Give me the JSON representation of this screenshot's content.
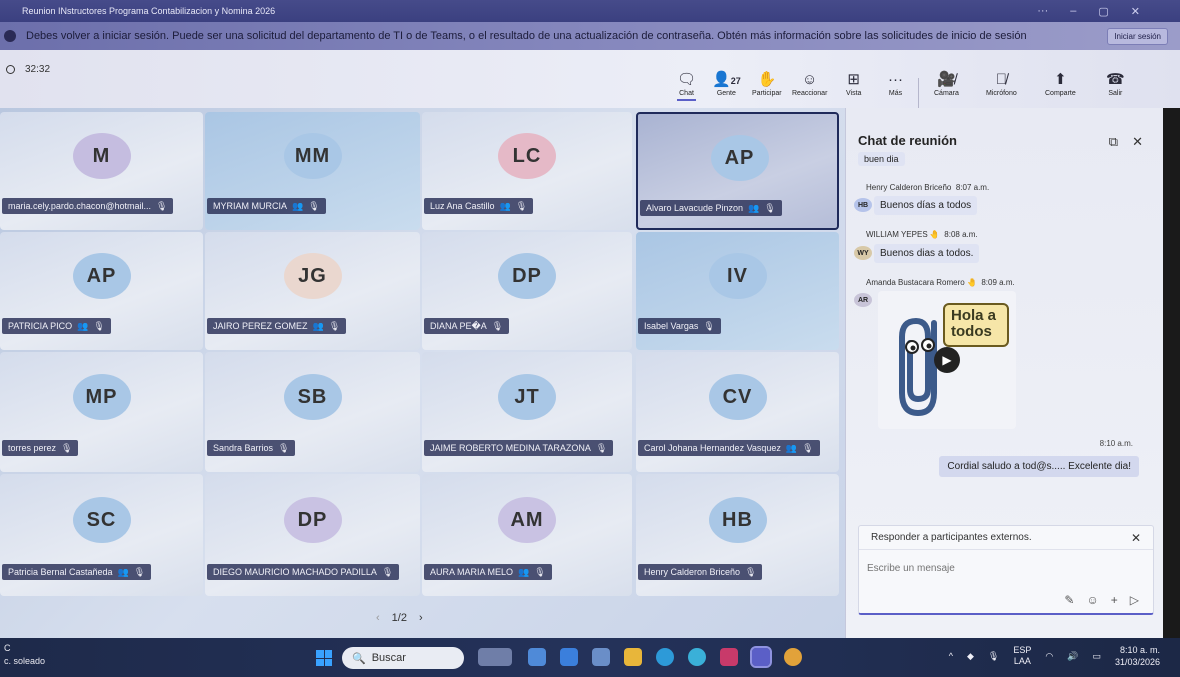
{
  "window": {
    "title": "Reunion INstructores Programa Contabilizacion y Nomina 2026",
    "controls": [
      "···",
      "–",
      "▢",
      "✕"
    ]
  },
  "banner": {
    "message": "Debes volver a iniciar sesión. Puede ser una solicitud del departamento de TI o de Teams, o el resultado de una actualización de contraseña. Obtén más información sobre las solicitudes de inicio de sesión",
    "button": "Iniciar sesión"
  },
  "toolbar": {
    "timer": "32:32",
    "people_count": "27",
    "buttons": {
      "chat": "Chat",
      "people": "Gente",
      "raise": "Participar",
      "react": "Reaccionar",
      "view": "Vista",
      "more": "Más",
      "camera": "Cámara",
      "mic": "Micrófono",
      "share": "Comparte",
      "leave": "Salir"
    },
    "icons": {
      "chat": "chat-icon",
      "people": "people-icon",
      "raise": "hand-icon",
      "react": "smile-icon",
      "view": "grid-icon",
      "more": "more-icon",
      "camera": "camera-off-icon",
      "mic": "mic-off-icon",
      "share": "share-icon",
      "leave": "phone-icon"
    }
  },
  "tiles": [
    {
      "initials": "M",
      "name": "maria.cely.pardo.chacon@hotmail...",
      "hand": false
    },
    {
      "initials": "MM",
      "name": "MYRIAM MURCIA",
      "hand": true
    },
    {
      "initials": "LC",
      "name": "Luz Ana Castillo",
      "hand": true
    },
    {
      "initials": "AP",
      "name": "Alvaro Lavacude Pinzon",
      "hand": true
    },
    {
      "initials": "AP",
      "name": "PATRICIA PICO",
      "hand": true
    },
    {
      "initials": "JG",
      "name": "JAIRO PEREZ GOMEZ",
      "hand": true
    },
    {
      "initials": "DP",
      "name": "DIANA PE�A",
      "hand": false
    },
    {
      "initials": "IV",
      "name": "Isabel Vargas",
      "hand": false
    },
    {
      "initials": "MP",
      "name": "torres perez",
      "hand": false
    },
    {
      "initials": "SB",
      "name": "Sandra Barrios",
      "hand": false
    },
    {
      "initials": "JT",
      "name": "JAIME ROBERTO MEDINA TARAZONA",
      "hand": false
    },
    {
      "initials": "CV",
      "name": "Carol Johana Hernandez Vasquez",
      "hand": true
    },
    {
      "initials": "SC",
      "name": "Patricia Bernal Castañeda",
      "hand": true
    },
    {
      "initials": "DP",
      "name": "DIEGO MAURICIO MACHADO PADILLA",
      "hand": false
    },
    {
      "initials": "AM",
      "name": "AURA MARIA MELO",
      "hand": true
    },
    {
      "initials": "HB",
      "name": "Henry Calderon Briceño",
      "hand": false
    }
  ],
  "pager": {
    "label": "1/2",
    "prev": "‹",
    "next": "›"
  },
  "chat": {
    "title": "Chat de reunión",
    "messages": [
      {
        "text": "buen dia"
      },
      {
        "sender": "Henry Calderon Briceño",
        "time": "8:07 a.m.",
        "initials": "HB",
        "text": "Buenos días a todos"
      },
      {
        "sender": "WILLIAM YEPES",
        "time": "8:08 a.m.",
        "initials": "WY",
        "text": "Buenos dias a todos."
      },
      {
        "sender": "Amanda Bustacara Romero",
        "time": "8:09 a.m.",
        "initials": "AR",
        "gif_text": "Hola a todos"
      }
    ],
    "own": {
      "time": "8:10 a.m.",
      "text": "Cordial saludo a tod@s..... Excelente dia!"
    },
    "reply_external": "Responder a participantes externos.",
    "input_placeholder": "Escribe un mensaje"
  },
  "taskbar": {
    "weather_temp": "C",
    "weather_label": "c. soleado",
    "search_label": "Buscar",
    "lang": [
      "ESP",
      "LAA"
    ],
    "time": "8:10 a. m.",
    "date": "31/03/2026"
  },
  "colors": {
    "accent": "#5b5fc7",
    "banner": "#8587bd",
    "taskbar": "#1e2a4a"
  }
}
